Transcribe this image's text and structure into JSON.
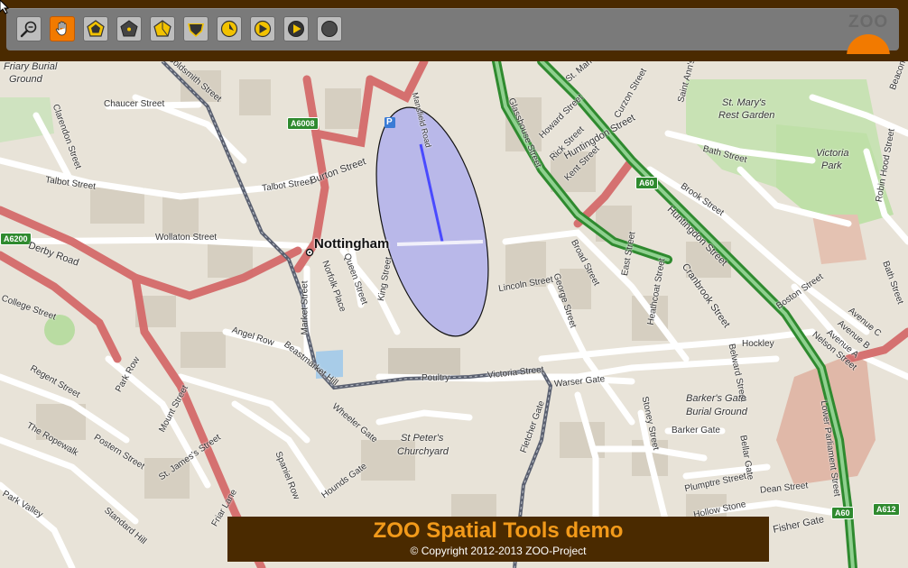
{
  "toolbar": {
    "tools": [
      {
        "name": "zoom-out",
        "icon": "magnifier-minus-icon",
        "active": false
      },
      {
        "name": "pan",
        "icon": "hand-icon",
        "active": true
      },
      {
        "name": "buffer",
        "icon": "polygon-buffer-icon",
        "active": false
      },
      {
        "name": "centroid",
        "icon": "polygon-centroid-icon",
        "active": false
      },
      {
        "name": "boundary",
        "icon": "polygon-boundary-icon",
        "active": false
      },
      {
        "name": "convex-hull",
        "icon": "polygon-dark-icon",
        "active": false
      },
      {
        "name": "simplify",
        "icon": "circle-arrow-icon",
        "active": false
      },
      {
        "name": "union",
        "icon": "circle-play-icon",
        "active": false
      },
      {
        "name": "intersection",
        "icon": "circle-play-alt-icon",
        "active": false
      },
      {
        "name": "difference",
        "icon": "dark-circle-icon",
        "active": false
      }
    ],
    "logo_text": "ZOO"
  },
  "colors": {
    "frame": "#4a2a00",
    "toolbar": "#7a7a7a",
    "accent": "#f27a00",
    "footer_title": "#f29a1a",
    "buffer_fill": "#a9a9ef",
    "line": "#5a5aff"
  },
  "map": {
    "labels": {
      "nottingham": "Nottingham",
      "derby_road": "Derby Road",
      "wollaton_street": "Wollaton Street",
      "talbot_street_w": "Talbot Street",
      "talbot_street_e": "Talbot Street",
      "burton_street": "Burton Street",
      "chaucer_street": "Chaucer Street",
      "goldsmith_street": "Goldsmith Street",
      "clarendon_street": "Clarendon Street",
      "friary_burial_ground": "Friary Burial",
      "friary_burial_ground2": "Ground",
      "mansfield_road": "Mansfield Road",
      "glasshouse_street": "Glasshouse Street",
      "huntingdon_street": "Huntingdon Street",
      "huntingdon_street2": "Huntingdon Street",
      "st_marys_rest_garden": "St. Mary's",
      "st_marys_rest_garden2": "Rest Garden",
      "victoria_park": "Victoria",
      "victoria_park2": "Park",
      "bath_street": "Bath Street",
      "brook_street": "Brook Street",
      "lincoln_street": "Lincoln Street",
      "george_street": "George Street",
      "broad_street": "Broad Street",
      "heathcoat_street": "Heathcoat Street",
      "cranbrook_street": "Cranbrook Street",
      "belward_street": "Belward Street",
      "hockley": "Hockley",
      "barkers_gate_burial": "Barker's Gate",
      "barkers_gate_burial2": "Burial Ground",
      "barker_gate": "Barker Gate",
      "poultry": "Poultry",
      "victoria_street": "Victoria Street",
      "warser_gate": "Warser Gate",
      "angel_row": "Angel Row",
      "beastmarket_hill": "Beastmarket Hill",
      "wheeler_gate": "Wheeler Gate",
      "st_peters_churchyard": "St Peter's",
      "st_peters_churchyard2": "Churchyard",
      "market_street": "Market Street",
      "king_street": "King Street",
      "queen_street": "Queen Street",
      "norfolk_place": "Norfolk Place",
      "regent_street": "Regent Street",
      "park_row": "Park Row",
      "the_ropewalk": "The Ropewalk",
      "postern_street": "Postern Street",
      "st_james_street": "St. James's Street",
      "mount_street": "Mount Street",
      "park_valley": "Park Valley",
      "standard_hill": "Standard Hill",
      "friar_lane": "Friar Lane",
      "spaniel_row": "Spaniel Row",
      "hounds_gate": "Hounds Gate",
      "fletcher_gate": "Fletcher Gate",
      "stoney_street": "Stoney Street",
      "plumptre_street": "Plumptre Street",
      "hollow_stone": "Hollow Stone",
      "dean_street": "Dean Street",
      "fisher_gate": "Fisher Gate",
      "lower_parliament_street": "Lower Parliament Street",
      "bellar_gate": "Bellar Gate",
      "college_street": "College Street",
      "howard_street": "Howard Street",
      "kent_street": "Kent Street",
      "curzon_street": "Curzon Street",
      "st_marks": "St. Mark",
      "saint_anns": "Saint Ann's",
      "boston_street": "Boston Street",
      "avenue_c": "Avenue C",
      "avenue_b": "Avenue B",
      "avenue_a": "Avenue A",
      "nelson_street": "Nelson Street",
      "robin_hood_street": "Robin Hood Street",
      "bath_street2": "Bath Street",
      "east_street": "East Street",
      "rick_street": "Rick Street",
      "bosworth": "Beacon"
    },
    "shields": {
      "a6008": "A6008",
      "a60_top": "A60",
      "a6200": "A6200",
      "a60_bottom": "A60",
      "a612": "A612"
    },
    "parking_symbol": "P"
  },
  "footer": {
    "title": "ZOO Spatial Tools demo",
    "copyright": "© Copyright 2012-2013 ZOO-Project"
  }
}
